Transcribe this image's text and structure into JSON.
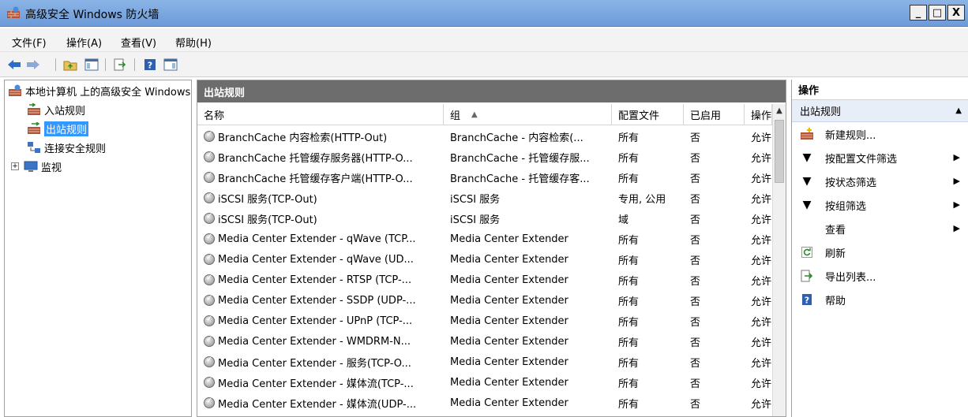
{
  "window": {
    "title": "高级安全 Windows 防火墙",
    "min_label": "_",
    "max_label": "□",
    "close_label": "X"
  },
  "menu": [
    "文件(F)",
    "操作(A)",
    "查看(V)",
    "帮助(H)"
  ],
  "toolbar": [
    "back-icon",
    "forward-icon",
    "up-folder-icon",
    "show-hide-tree-icon",
    "export-list-icon",
    "help-icon",
    "show-hide-action-icon"
  ],
  "tree": {
    "root": "本地计算机 上的高级安全 Windows",
    "items": [
      "入站规则",
      "出站规则",
      "连接安全规则",
      "监视"
    ],
    "selected": "出站规则",
    "expand_label": "+"
  },
  "center": {
    "header": "出站规则",
    "columns": [
      "名称",
      "组",
      "配置文件",
      "已启用",
      "操作"
    ],
    "sort_indicator": "▲",
    "rows": [
      [
        "BranchCache 内容检索(HTTP-Out)",
        "BranchCache - 内容检索(...",
        "所有",
        "否",
        "允许"
      ],
      [
        "BranchCache 托管缓存服务器(HTTP-O...",
        "BranchCache - 托管缓存服...",
        "所有",
        "否",
        "允许"
      ],
      [
        "BranchCache 托管缓存客户端(HTTP-O...",
        "BranchCache - 托管缓存客...",
        "所有",
        "否",
        "允许"
      ],
      [
        "iSCSI 服务(TCP-Out)",
        "iSCSI 服务",
        "专用, 公用",
        "否",
        "允许"
      ],
      [
        "iSCSI 服务(TCP-Out)",
        "iSCSI 服务",
        "域",
        "否",
        "允许"
      ],
      [
        "Media Center Extender - qWave (TCP...",
        "Media Center Extender",
        "所有",
        "否",
        "允许"
      ],
      [
        "Media Center Extender - qWave (UD...",
        "Media Center Extender",
        "所有",
        "否",
        "允许"
      ],
      [
        "Media Center Extender - RTSP (TCP-...",
        "Media Center Extender",
        "所有",
        "否",
        "允许"
      ],
      [
        "Media Center Extender - SSDP (UDP-...",
        "Media Center Extender",
        "所有",
        "否",
        "允许"
      ],
      [
        "Media Center Extender - UPnP (TCP-...",
        "Media Center Extender",
        "所有",
        "否",
        "允许"
      ],
      [
        "Media Center Extender - WMDRM-N...",
        "Media Center Extender",
        "所有",
        "否",
        "允许"
      ],
      [
        "Media Center Extender - 服务(TCP-O...",
        "Media Center Extender",
        "所有",
        "否",
        "允许"
      ],
      [
        "Media Center Extender - 媒体流(TCP-...",
        "Media Center Extender",
        "所有",
        "否",
        "允许"
      ],
      [
        "Media Center Extender - 媒体流(UDP-...",
        "Media Center Extender",
        "所有",
        "否",
        "允许"
      ]
    ]
  },
  "actions": {
    "title": "操作",
    "section": "出站规则",
    "items": [
      "新建规则...",
      "按配置文件筛选",
      "按状态筛选",
      "按组筛选",
      "查看",
      "刷新",
      "导出列表...",
      "帮助"
    ]
  },
  "colors": {
    "title_bar": "#7aa7e0",
    "selection": "#3399ff",
    "pane_header": "#6d6d6d"
  }
}
